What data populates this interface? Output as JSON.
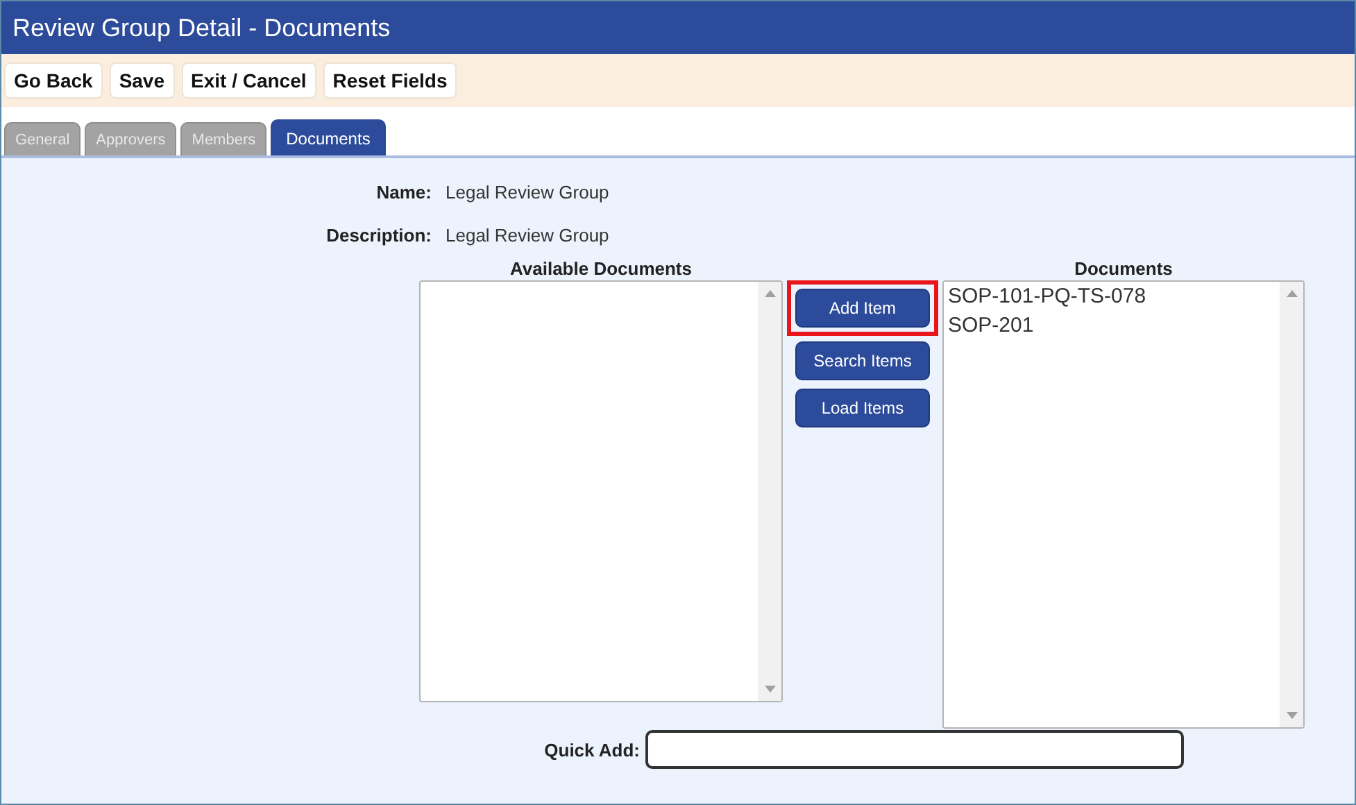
{
  "window": {
    "title": "Review Group Detail - Documents"
  },
  "toolbar": [
    "Go Back",
    "Save",
    "Exit / Cancel",
    "Reset Fields"
  ],
  "tabs": [
    {
      "label": "General",
      "selected": false
    },
    {
      "label": "Approvers",
      "selected": false
    },
    {
      "label": "Members",
      "selected": false
    },
    {
      "label": "Documents",
      "selected": true
    }
  ],
  "fields": [
    {
      "label": "Name:",
      "value": "Legal Review Group"
    },
    {
      "label": "Description:",
      "value": "Legal Review Group"
    }
  ],
  "available_documents": {
    "heading": "Available Documents"
  },
  "actions": [
    {
      "label": "Add Item",
      "highlighted": true
    },
    {
      "label": "Search Items",
      "highlighted": false
    },
    {
      "label": "Load Items",
      "highlighted": false
    }
  ],
  "documents": {
    "heading": "Documents",
    "items": [
      "SOP-101-PQ-TS-078",
      "SOP-201"
    ]
  },
  "quick_add": {
    "label": "Quick Add:"
  }
}
